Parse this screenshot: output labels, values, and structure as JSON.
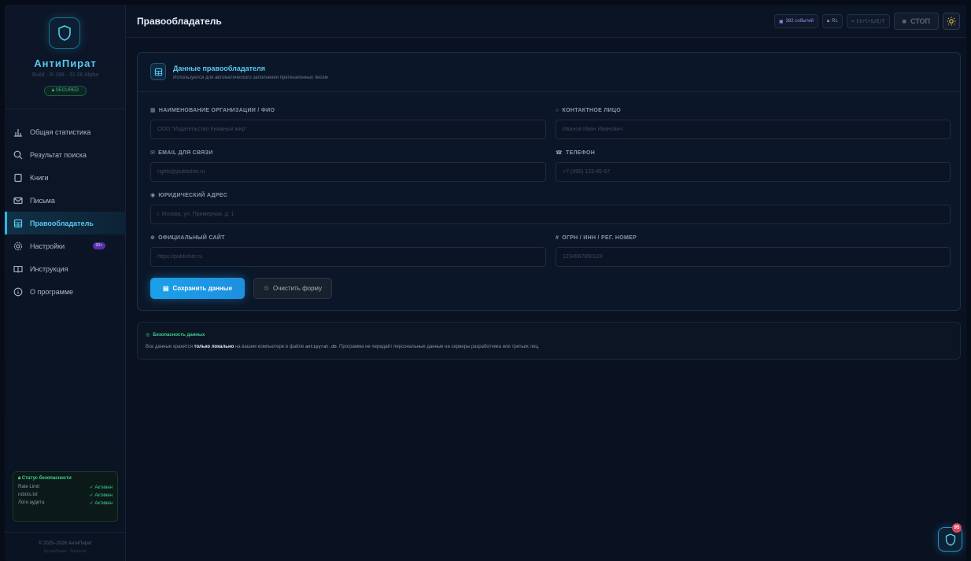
{
  "app": {
    "name": "АнтиПират",
    "build": "Build · R-198 · 31 06 Alpha",
    "secured_label": "SECURED",
    "copyright": "© 2025–2026 АнтиПират",
    "authors": "КуталИнамо · Supernito"
  },
  "sidebar": {
    "items": [
      {
        "label": "Общая статистика",
        "icon": "bar-chart-icon"
      },
      {
        "label": "Результат поиска",
        "icon": "search-icon"
      },
      {
        "label": "Книги",
        "icon": "book-icon"
      },
      {
        "label": "Письма",
        "icon": "mail-icon"
      },
      {
        "label": "Правообладатель",
        "icon": "building-icon",
        "active": true
      },
      {
        "label": "Настройки",
        "icon": "gear-icon",
        "badge": "99+"
      },
      {
        "label": "Инструкция",
        "icon": "open-book-icon"
      },
      {
        "label": "О программе",
        "icon": "info-icon"
      }
    ],
    "security": {
      "title": "Статус безопасности",
      "rows": [
        {
          "label": "Rate Limit",
          "status": "Активен"
        },
        {
          "label": "robots.txt",
          "status": "Активен"
        },
        {
          "label": "Логи аудита",
          "status": "Активен"
        }
      ]
    }
  },
  "topbar": {
    "title": "Правообладатель",
    "events": "382 событий",
    "locale": "RL",
    "shortcut": "Ctrl+S/E/T",
    "stop": "СТОП"
  },
  "card": {
    "title": "Данные правообладателя",
    "subtitle": "Используются для автоматического заполнения претензионных писем",
    "fields": {
      "org": {
        "label": "НАИМЕНОВАНИЕ ОРГАНИЗАЦИИ / ФИО",
        "placeholder": "ООО \"Издательство Книжный мир\"",
        "value": ""
      },
      "contact": {
        "label": "КОНТАКТНОЕ ЛИЦО",
        "placeholder": "Иванов Иван Иванович",
        "value": ""
      },
      "email": {
        "label": "EMAIL ДЛЯ СВЯЗИ",
        "placeholder": "rights@publisher.ru",
        "value": ""
      },
      "phone": {
        "label": "ТЕЛЕФОН",
        "placeholder": "+7 (495) 123-45-67",
        "value": ""
      },
      "address": {
        "label": "ЮРИДИЧЕСКИЙ АДРЕС",
        "placeholder": "г. Москва, ул. Примерная, д. 1",
        "value": ""
      },
      "site": {
        "label": "ОФИЦИАЛЬНЫЙ САЙТ",
        "placeholder": "https://publisher.ru",
        "value": ""
      },
      "ogrn": {
        "label": "ОГРН / ИНН / РЕГ. НОМЕР",
        "placeholder": "1234567890123",
        "value": ""
      }
    },
    "save_label": "Сохранить данные",
    "clear_label": "Очистить форму"
  },
  "info": {
    "title": "Безопасность данных",
    "text_before": "Все данные хранятся ",
    "text_bold": "только локально",
    "text_mid": " на вашем компьютере в файле ",
    "text_code": "antipyrat.db",
    "text_after": ". Программа не передаёт персональные данные на серверы разработчика или третьих лиц."
  },
  "fab": {
    "badge": "95"
  },
  "colors": {
    "accent": "#2fb5e8",
    "success": "#3fcf8e",
    "danger": "#e0445c",
    "background": "#0a1222"
  }
}
